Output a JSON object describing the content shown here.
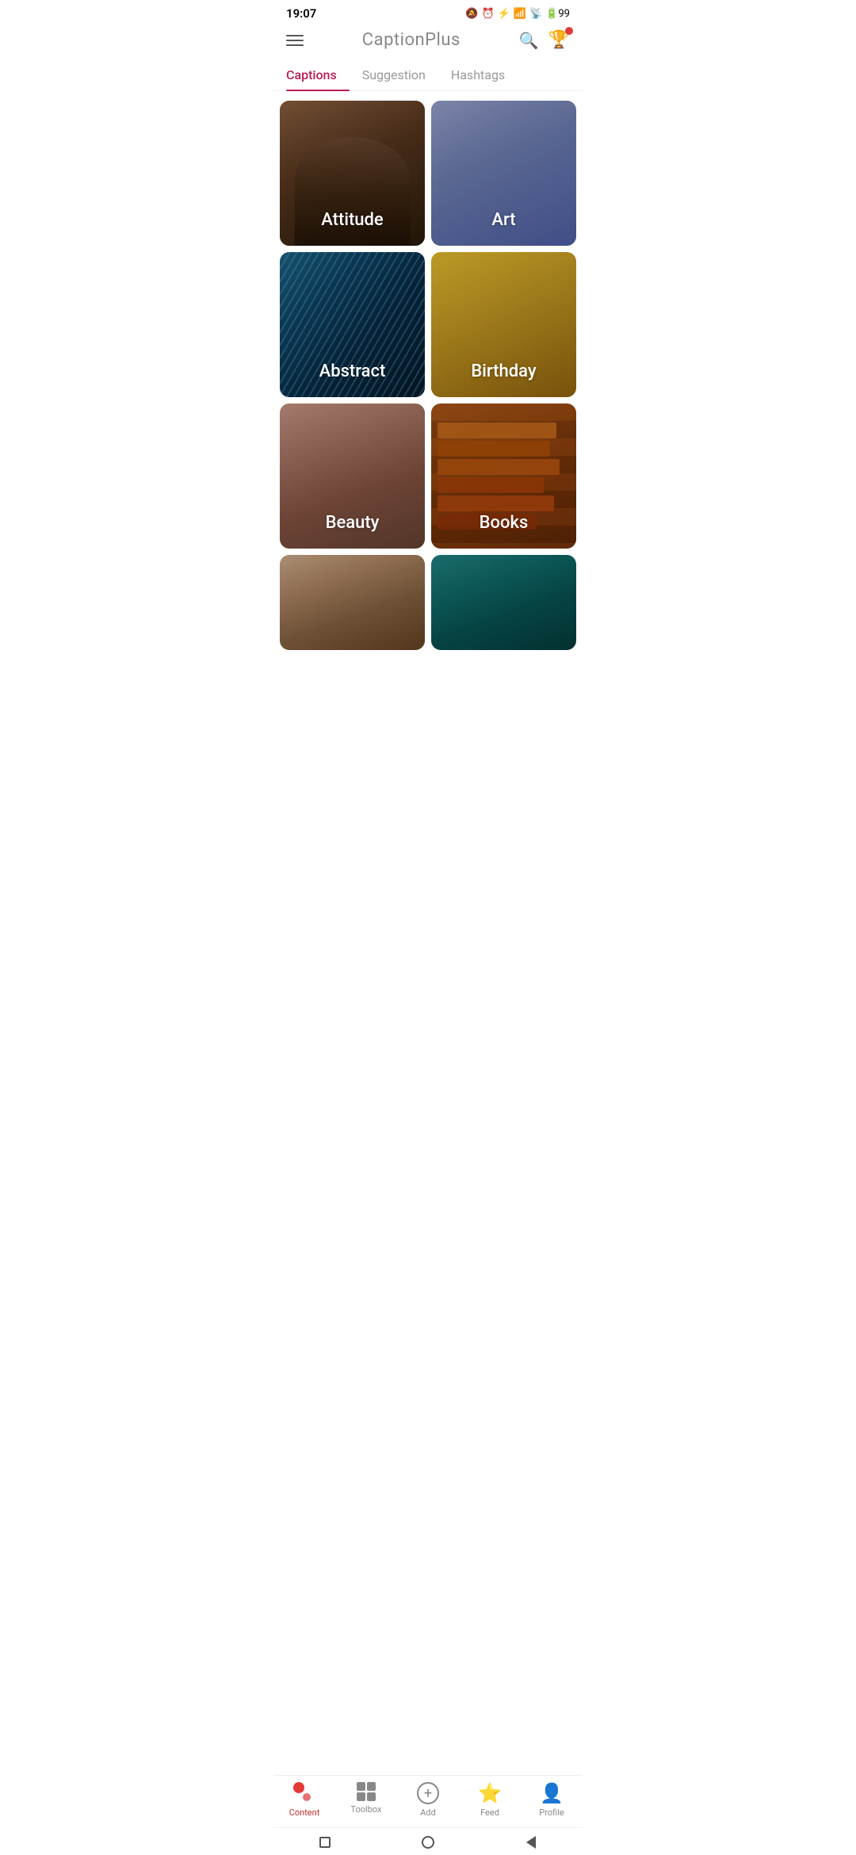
{
  "statusBar": {
    "time": "19:07",
    "battery": "99"
  },
  "header": {
    "title": "CaptionPlus",
    "searchLabel": "search",
    "trophyLabel": "trophy"
  },
  "tabs": [
    {
      "id": "captions",
      "label": "Captions",
      "active": true
    },
    {
      "id": "suggestion",
      "label": "Suggestion",
      "active": false
    },
    {
      "id": "hashtags",
      "label": "Hashtags",
      "active": false
    }
  ],
  "cards": [
    {
      "id": "attitude",
      "label": "Attitude",
      "theme": "attitude"
    },
    {
      "id": "art",
      "label": "Art",
      "theme": "art"
    },
    {
      "id": "abstract",
      "label": "Abstract",
      "theme": "abstract"
    },
    {
      "id": "birthday",
      "label": "Birthday",
      "theme": "birthday"
    },
    {
      "id": "beauty",
      "label": "Beauty",
      "theme": "beauty"
    },
    {
      "id": "books",
      "label": "Books",
      "theme": "books"
    },
    {
      "id": "boy",
      "label": "",
      "theme": "boy"
    },
    {
      "id": "teal",
      "label": "",
      "theme": "teal"
    }
  ],
  "bottomNav": [
    {
      "id": "content",
      "label": "Content",
      "active": true,
      "icon": "dots"
    },
    {
      "id": "toolbox",
      "label": "Toolbox",
      "active": false,
      "icon": "grid"
    },
    {
      "id": "add",
      "label": "Add",
      "active": false,
      "icon": "plus-circle"
    },
    {
      "id": "feed",
      "label": "Feed",
      "active": false,
      "icon": "star"
    },
    {
      "id": "profile",
      "label": "Profile",
      "active": false,
      "icon": "person"
    }
  ]
}
